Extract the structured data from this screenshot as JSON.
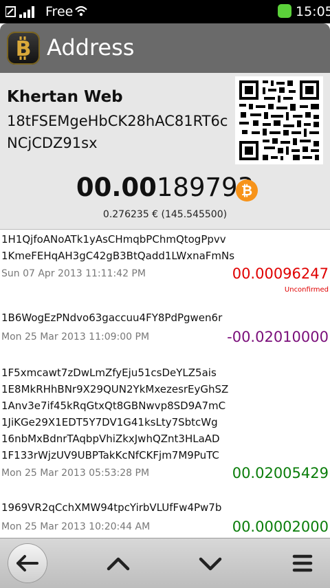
{
  "status_bar": {
    "carrier": "Free",
    "time": "15:05"
  },
  "header": {
    "title": "Address",
    "app_icon": "bitcoin-app-icon"
  },
  "summary": {
    "name": "Khertan Web",
    "address_line1": "18tFSEMgeHbCK28hAC81RT6c",
    "address_line2": "NCjCDZ91sx",
    "balance_bold": "00.00",
    "balance_rest": "189793",
    "currency_icon": "bitcoin-coin-icon",
    "fiat": "0.276235 € (145.545500)"
  },
  "transactions": [
    {
      "addresses": [
        "1H1QjfoANoATk1yAsCHmqbPChmQtogPpvv",
        "1KmeFEHqAH3gC42gB3BtQadd1LWxnaFmNs"
      ],
      "date": "Sun 07 Apr 2013 11:11:42 PM",
      "amount": "00.00096247",
      "status": "Unconfirmed",
      "color": "#e00000"
    },
    {
      "addresses": [
        "1B6WogEzPNdvo63gaccuu4FY8PdPgwen6r"
      ],
      "date": "Mon 25 Mar 2013 11:09:00 PM",
      "amount": "-00.02010000",
      "status": "",
      "color": "#7a0e7a"
    },
    {
      "addresses": [
        "1F5xmcawt7zDwLmZfyEju51csDeYLZ5ais",
        "1E8MkRHhBNr9X29QUN2YkMxezesrEyGhSZ",
        "1Anv3e7if45kRqGtxQt8GBNwvp8SD9A7mC",
        "1JiKGe29X1EDT5Y7DV1G41ksLty7SbtcWg",
        "16nbMxBdnrTAqbpVhiZkxJwhQZnt3HLaAD",
        "1F133rWjzUV9UBPTakKcNfCKFjm7M9PuTC"
      ],
      "date": "Mon 25 Mar 2013 05:53:28 PM",
      "amount": "00.02005429",
      "status": "",
      "color": "#0a7d0a"
    },
    {
      "addresses": [
        "1969VR2qCchXMW94tpcYirbVLUfFw4Pw7b"
      ],
      "date": "Mon 25 Mar 2013 10:20:44 AM",
      "amount": "00.00002000",
      "status": "",
      "color": "#0a7d0a"
    }
  ],
  "toolbar": {
    "back_icon": "back-arrow-icon",
    "up_icon": "chevron-up-icon",
    "down_icon": "chevron-down-icon",
    "menu_icon": "menu-icon"
  }
}
